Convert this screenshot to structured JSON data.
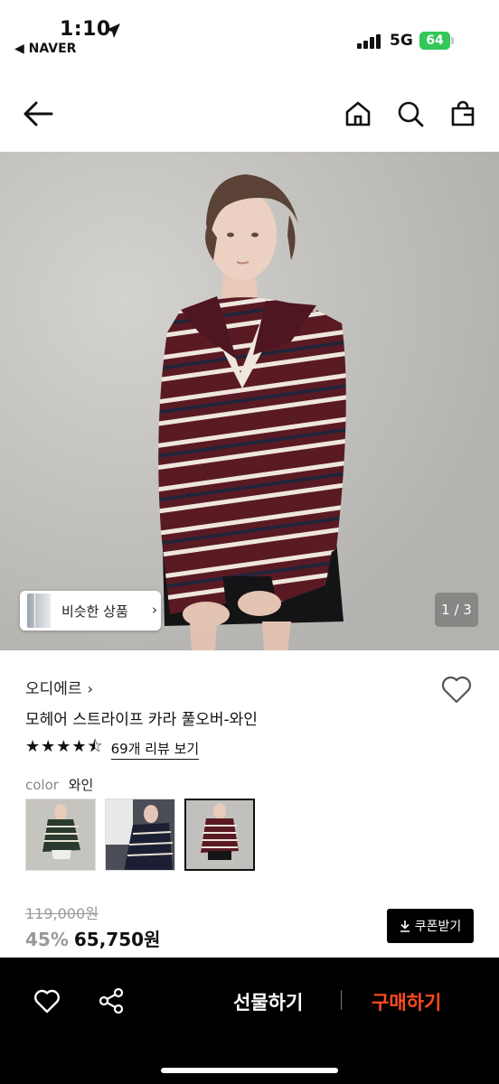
{
  "status_bar": {
    "time": "1:10",
    "back_app": "◀ NAVER",
    "network": "5G",
    "battery": "64"
  },
  "nav": {
    "back_icon": "arrow-left-icon",
    "home_icon": "home-icon",
    "search_icon": "search-icon",
    "bag_icon": "shopping-bag-icon"
  },
  "gallery": {
    "similar_label": "비슷한 상품",
    "similar_chevron": "›",
    "page_indicator": "1 / 3",
    "current_page": 1,
    "total_pages": 3
  },
  "product": {
    "brand": "오디에르",
    "brand_chevron": "›",
    "name": "모헤어 스트라이프 카라 풀오버-와인",
    "rating": 4.5,
    "stars": "★★★★⯪",
    "review_link": "69개 리뷰 보기",
    "color_key": "color",
    "color_value": "와인",
    "swatches": [
      {
        "name": "green-stripe",
        "selected": false
      },
      {
        "name": "navy-stripe",
        "selected": false
      },
      {
        "name": "wine-stripe",
        "selected": true
      }
    ],
    "original_price": "119,000원",
    "discount": "45%",
    "price": "65,750원",
    "coupon_label": "쿠폰받기"
  },
  "bottom_bar": {
    "gift_label": "선물하기",
    "buy_label": "구매하기",
    "buy_color": "#ff4b1f"
  },
  "colors": {
    "sweater_wine": "#5a1a24",
    "stripe_cream": "#efe6dc",
    "stripe_navy": "#222438",
    "battery_green": "#34c759"
  }
}
